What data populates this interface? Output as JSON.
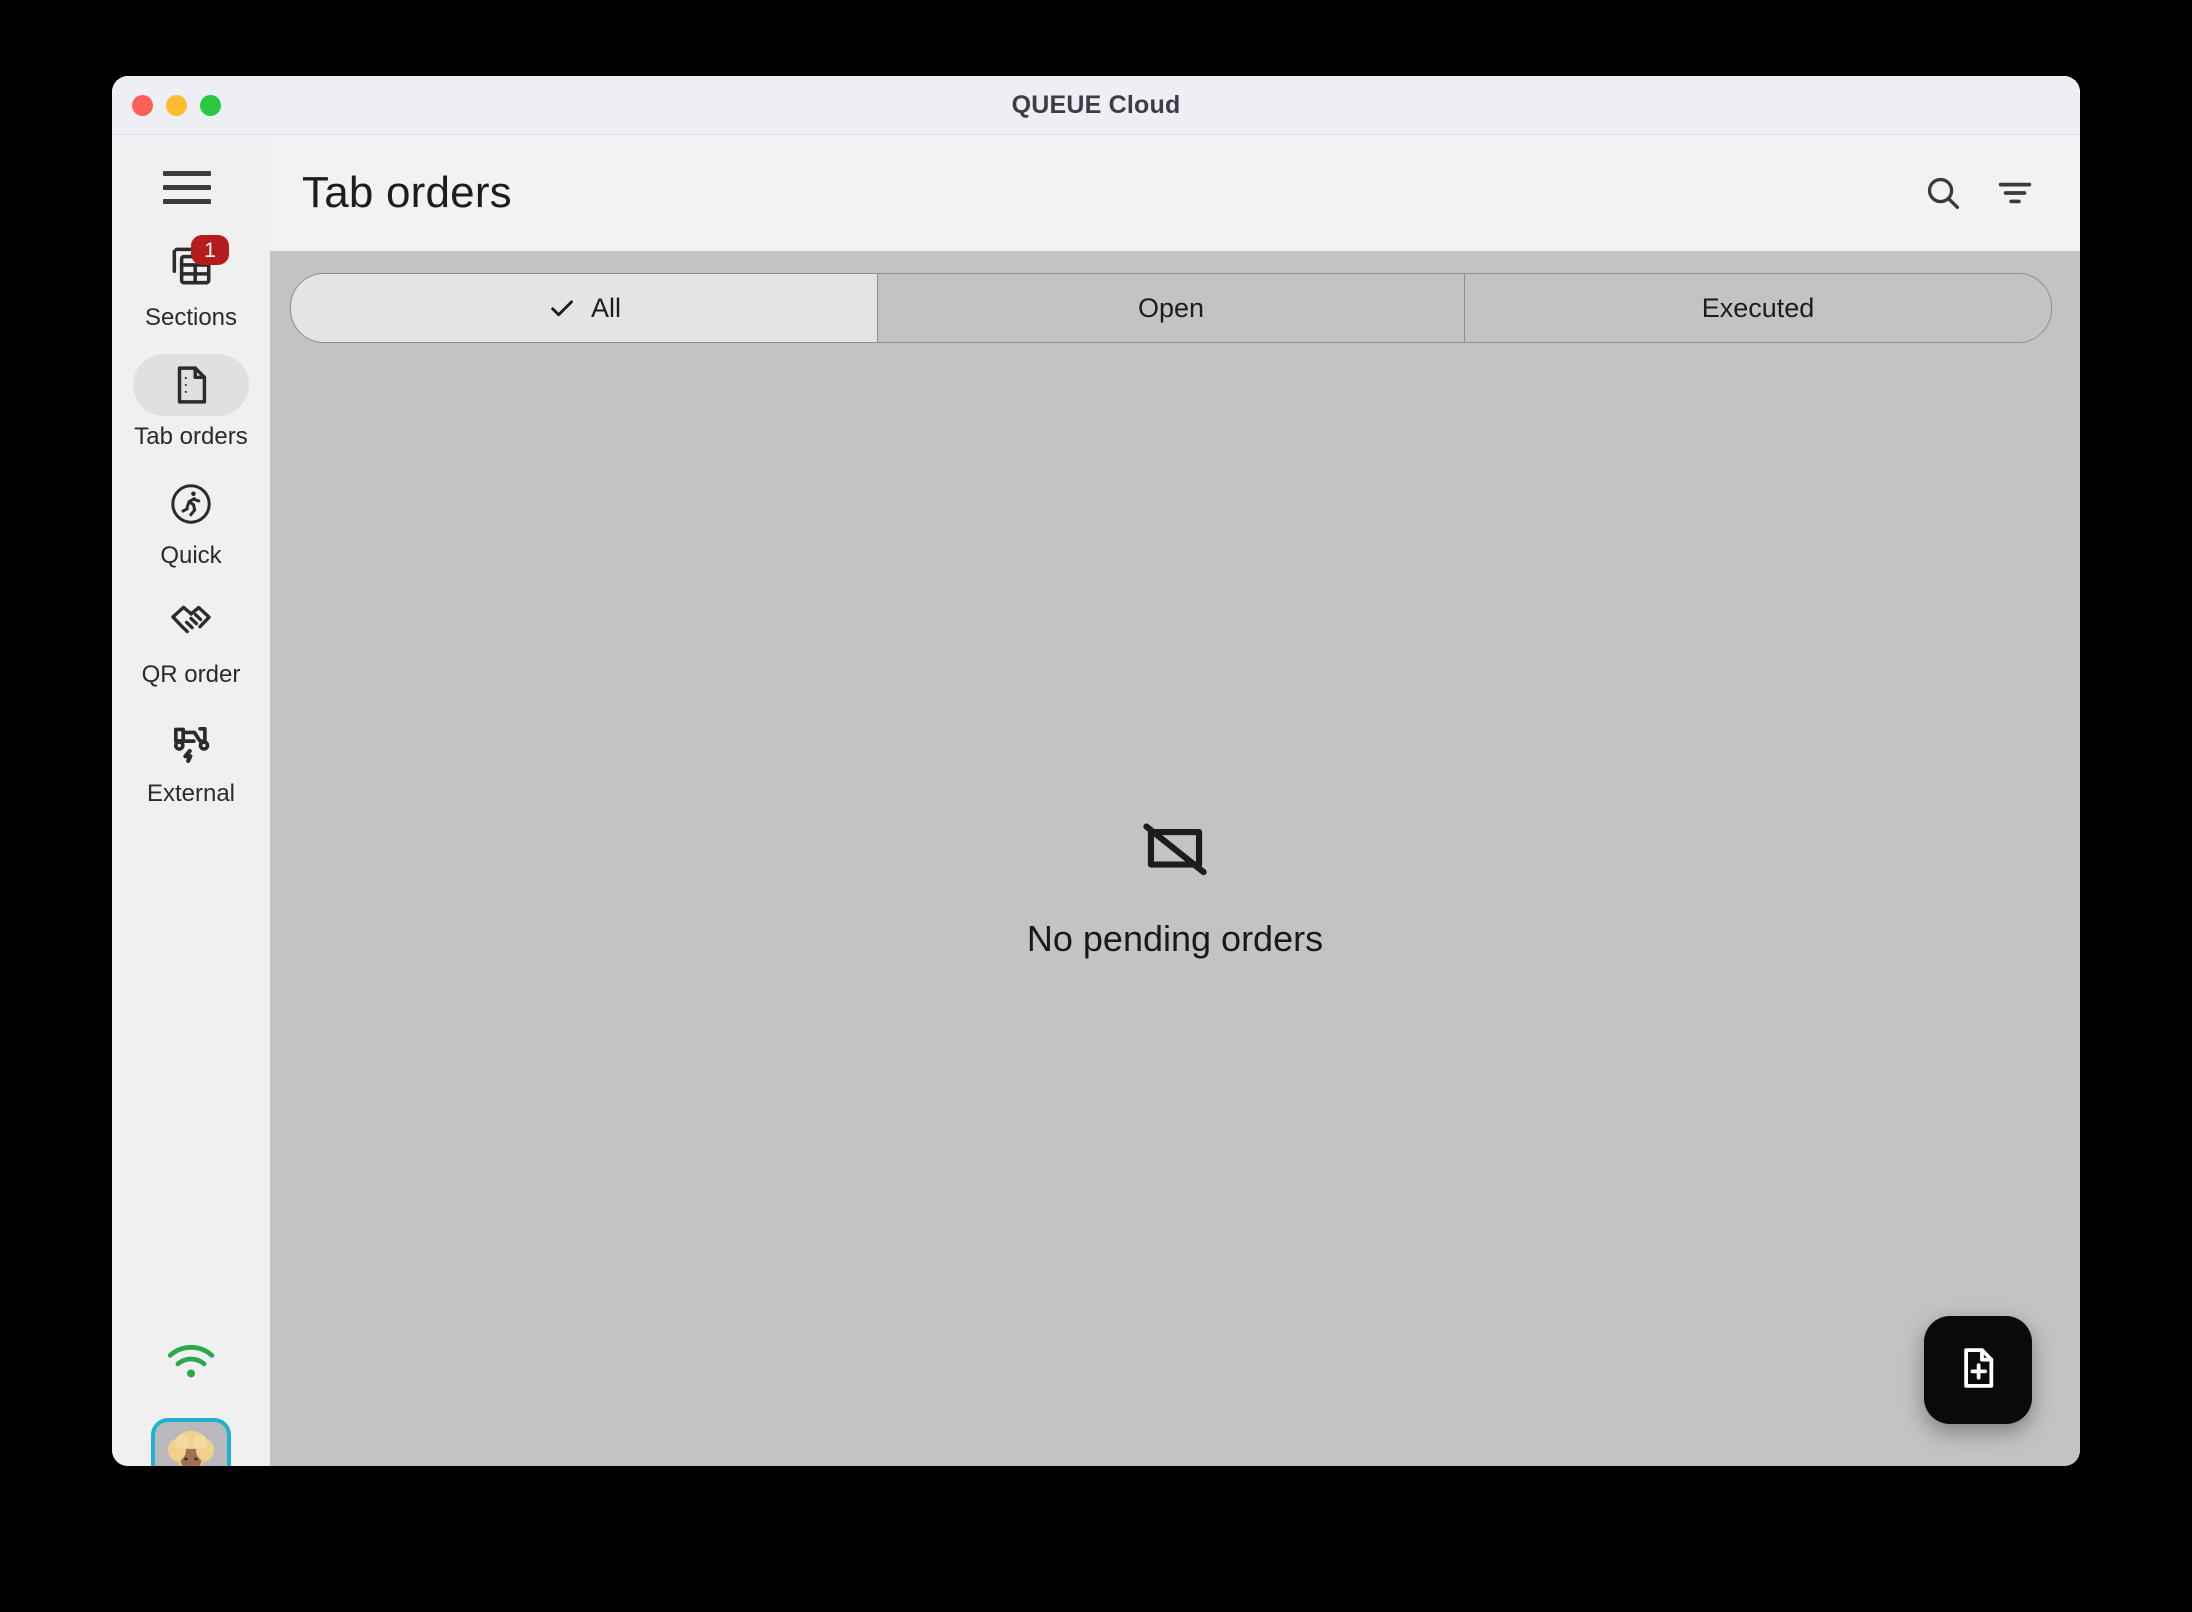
{
  "window": {
    "title": "QUEUE Cloud",
    "traffic_lights": [
      {
        "name": "close",
        "color": "#ff5f57"
      },
      {
        "name": "minimize",
        "color": "#febc2e"
      },
      {
        "name": "maximize",
        "color": "#28c840"
      }
    ]
  },
  "header": {
    "menu_icon": "hamburger-menu-icon",
    "title": "Tab orders",
    "actions": [
      {
        "icon": "search-icon",
        "label": "Search"
      },
      {
        "icon": "filter-icon",
        "label": "Filter"
      }
    ]
  },
  "sidebar": {
    "items": [
      {
        "label": "Sections",
        "icon": "table-sections-icon",
        "badge": "1",
        "active": false
      },
      {
        "label": "Tab orders",
        "icon": "document-icon",
        "badge": "",
        "active": true
      },
      {
        "label": "Quick",
        "icon": "runner-circle-icon",
        "badge": "",
        "active": false
      },
      {
        "label": "QR order",
        "icon": "handshake-icon",
        "badge": "",
        "active": false
      },
      {
        "label": "External",
        "icon": "scooter-icon",
        "badge": "",
        "active": false
      }
    ],
    "status": {
      "icon": "wifi-icon",
      "color": "#2aa84a",
      "label": "Connected"
    },
    "avatar": {
      "icon": "user-avatar",
      "border_color": "#1eb2cf"
    }
  },
  "tabs": {
    "selected": "All",
    "check_icon": "check-icon",
    "items": [
      {
        "label": "All",
        "selected": true
      },
      {
        "label": "Open",
        "selected": false
      },
      {
        "label": "Executed",
        "selected": false
      }
    ]
  },
  "empty_state": {
    "icon": "no-orders-icon",
    "message": "No pending orders"
  },
  "fab": {
    "icon": "new-document-icon",
    "label": "New order",
    "background": "#0a0a0a"
  },
  "colors": {
    "titlebar": "#eeeef5",
    "sidebar": "#f0f0f0",
    "topbar": "#f2f2f2",
    "content": "#c3c3c3",
    "segment_selected": "#e4e4e4",
    "badge": "#b61c1c"
  }
}
